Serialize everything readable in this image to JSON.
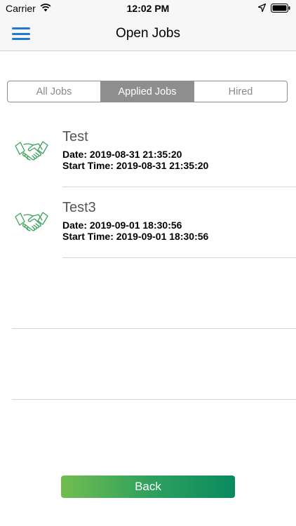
{
  "status_bar": {
    "carrier": "Carrier",
    "time": "12:02 PM"
  },
  "nav": {
    "title": "Open Jobs",
    "menu_icon": "hamburger-menu-icon"
  },
  "segments": [
    {
      "label": "All Jobs",
      "selected": false
    },
    {
      "label": "Applied Jobs",
      "selected": true
    },
    {
      "label": "Hired",
      "selected": false
    }
  ],
  "jobs": [
    {
      "title": "Test",
      "date": "Date: 2019-08-31 21:35:20",
      "start_time": "Start Time: 2019-08-31 21:35:20",
      "icon": "handshake-icon"
    },
    {
      "title": "Test3",
      "date": "Date: 2019-09-01 18:30:56",
      "start_time": "Start Time: 2019-09-01 18:30:56",
      "icon": "handshake-icon"
    }
  ],
  "footer": {
    "back_label": "Back"
  },
  "colors": {
    "accent_blue": "#1e7ad4",
    "segment_gray": "#8e8e8e",
    "icon_green": "#3aa35a",
    "button_gradient_start": "#72bd4f",
    "button_gradient_end": "#0a8a5f"
  }
}
